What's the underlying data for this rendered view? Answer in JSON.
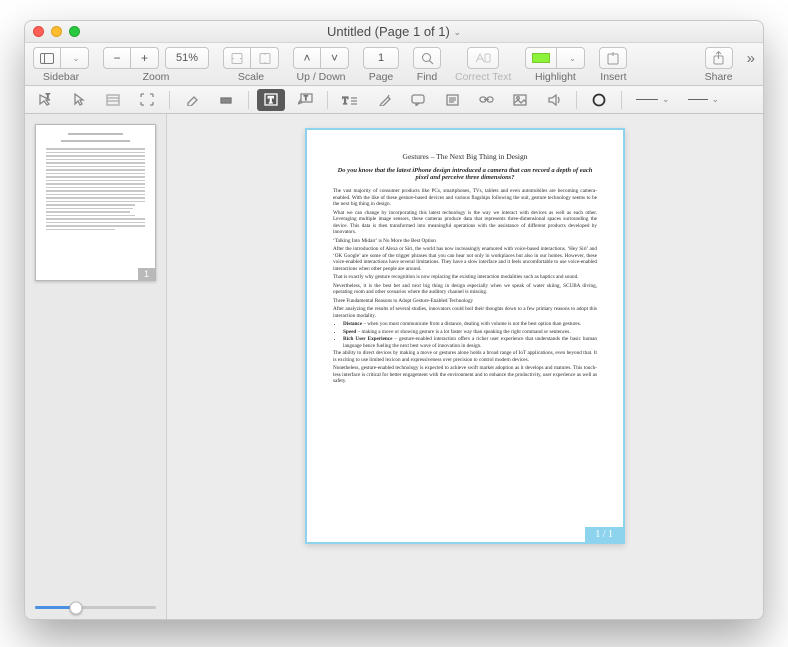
{
  "window": {
    "title": "Untitled (Page 1 of 1)"
  },
  "toolbar": {
    "sidebar_label": "Sidebar",
    "zoom_label": "Zoom",
    "zoom_minus": "−",
    "zoom_plus": "+",
    "zoom_value": "51%",
    "scale_label": "Scale",
    "updown_label": "Up / Down",
    "page_label": "Page",
    "page_value": "1",
    "find_label": "Find",
    "correct_label": "Correct Text",
    "highlight_label": "Highlight",
    "insert_label": "Insert",
    "share_label": "Share"
  },
  "sidebar": {
    "thumb_badge": "1",
    "slider_percent": 34
  },
  "page": {
    "badge": "1 / 1"
  },
  "colors": {
    "selection_blue": "#8ed3ee",
    "highlighter": "#8df23a"
  },
  "document": {
    "title": "Gestures – The Next Big Thing in Design",
    "subtitle": "Do you know that the latest iPhone design introduced a camera that can record a depth of each pixel and perceive three dimensions?",
    "paragraphs": [
      "The vast majority of consumer products like PCs, smartphones, TVs, tablets and even automobiles are becoming camera-enabled. With the like of these gesture-based devices and various flagships following the suit, gesture technology seems to be the next big thing in design.",
      "What we can change by incorporating this latest technology is the way we interact with devices as well as each other. Leveraging multiple image sensors, these cameras produce data that represents three-dimensional spaces surrounding the device. This data is then transformed into meaningful operations with the assistance of different products developed by innovators.",
      "‘Talking Into Midair’ is No More the Best Option",
      "After the introduction of Alexa or Siri, the world has now increasingly enamored with voice-based interactions. ‘Hey Siri’ and ‘OK Google’ are some of the trigger phrases that you can hear not only in workplaces but also in our homes. However, these voice-enabled interactions have several limitations. They have a slow interface and it feels uncomfortable to use voice-enabled interactions when other people are around.",
      "That is exactly why gesture recognition is now replacing the existing interaction modalities such as haptics and sound.",
      "Nevertheless, it is the best bet and next big thing in design especially when we speak of water skiing, SCUBA diving, operating room and other scenarios where the auditory channel is missing.",
      "Three Fundamental Reasons to Adopt Gesture-Enabled Technology",
      "After analyzing the results of several studies, innovators could boil their thoughts down to a few primary reasons to adopt this interaction modality."
    ],
    "bullets": [
      {
        "label": "Distance",
        "text": " – when you must communicate from a distance, dealing with volume is not the best option than gestures."
      },
      {
        "label": "Speed",
        "text": " – making a move or showing gesture is a lot faster way than speaking the right command or sentences."
      },
      {
        "label": "Rich User Experience",
        "text": " – gesture-enabled interaction offers a richer user experience that understands the basic human language hence fueling the next best wave of innovation in design."
      }
    ],
    "paragraphs_after": [
      "The ability to direct devices by making a move or gestures alone holds a broad range of IoT applications, even beyond that. It is exciting to use limited lexicon and expressiveness over precision to control modern devices.",
      "Nonetheless, gesture-enabled technology is expected to achieve swift market adoption as it develops and matures. This touch-less interface is critical for better engagement with the environment and to enhance the productivity, user experience as well as safety."
    ]
  }
}
